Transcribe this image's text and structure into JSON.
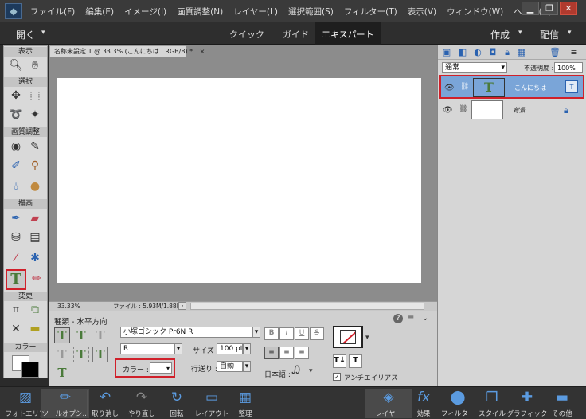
{
  "menu": {
    "items": [
      "ファイル(F)",
      "編集(E)",
      "イメージ(I)",
      "画質調整(N)",
      "レイヤー(L)",
      "選択範囲(S)",
      "フィルター(T)",
      "表示(V)",
      "ウィンドウ(W)",
      "ヘルプ(H)"
    ],
    "win_minimize": "▁",
    "win_restore": "❐",
    "win_close": "✕"
  },
  "mode": {
    "open_label": "開く",
    "quick": "クイック",
    "guided": "ガイド",
    "expert": "エキスパート",
    "create": "作成",
    "share": "配信"
  },
  "toolbox": {
    "sections": [
      "表示",
      "選択",
      "画質調整",
      "描画",
      "変更",
      "カラー"
    ]
  },
  "document": {
    "tab_title": "名称未設定 1 @ 33.3% (こんにちは , RGB/8) *",
    "tab_close": "×",
    "zoom": "33.33%",
    "file_info": "ファイル : 5.93M/1.88M"
  },
  "options": {
    "tool_title": "種類 - 水平方向",
    "font_family": "小塚ゴシック Pr6N R",
    "font_style": "R",
    "size_label": "サイズ :",
    "size_value": "100 pt",
    "color_label": "カラー :",
    "leading_label": "行送り :",
    "leading_value": "自動",
    "bold": "B",
    "italic": "I",
    "underline": "U",
    "strike": "S",
    "language_label": "日本語 :",
    "antialias": "アンチエイリアス"
  },
  "layers": {
    "blend_mode": "通常",
    "opacity_label": "不透明度 :",
    "opacity_value": "100%",
    "items": [
      {
        "name": "こんにちは",
        "thumb": "T"
      },
      {
        "name": "背景"
      }
    ]
  },
  "taskbar": {
    "items": [
      "フォトエリア",
      "ツールオプシ...",
      "取り消し",
      "やり直し",
      "回転",
      "レイアウト",
      "整理",
      "レイヤー",
      "効果",
      "フィルター",
      "スタイル",
      "グラフィック",
      "その他"
    ]
  },
  "colors": {
    "accent": "#5b9be0",
    "highlight_red": "#d0202a",
    "selected_layer": "#7aa5d8"
  }
}
